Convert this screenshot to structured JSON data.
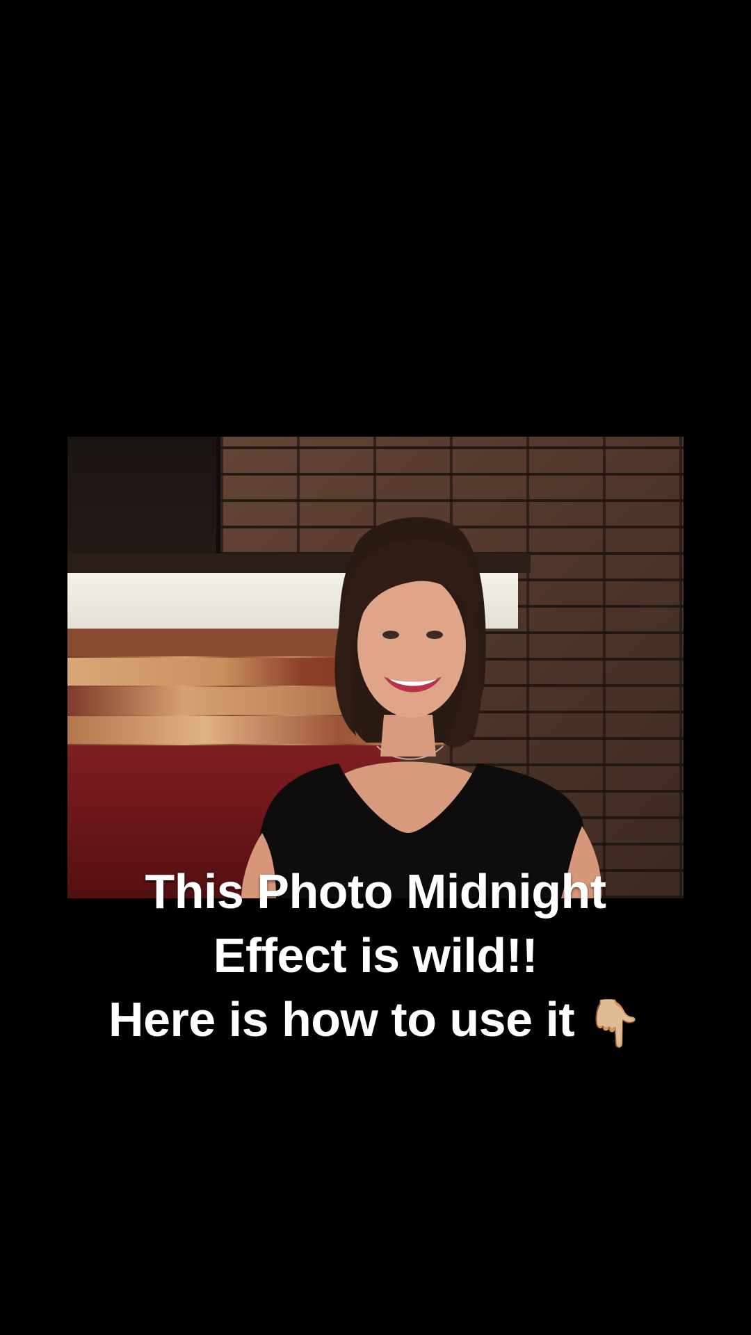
{
  "caption": {
    "line1": "This Photo Midnight",
    "line2": "Effect is wild!!",
    "line3": "Here is how to use it",
    "line3_emoji": "👇🏼"
  },
  "icons": {
    "pointer": "pointing-down-hand-icon"
  },
  "colors": {
    "background": "#000000",
    "caption_text": "#ffffff"
  }
}
